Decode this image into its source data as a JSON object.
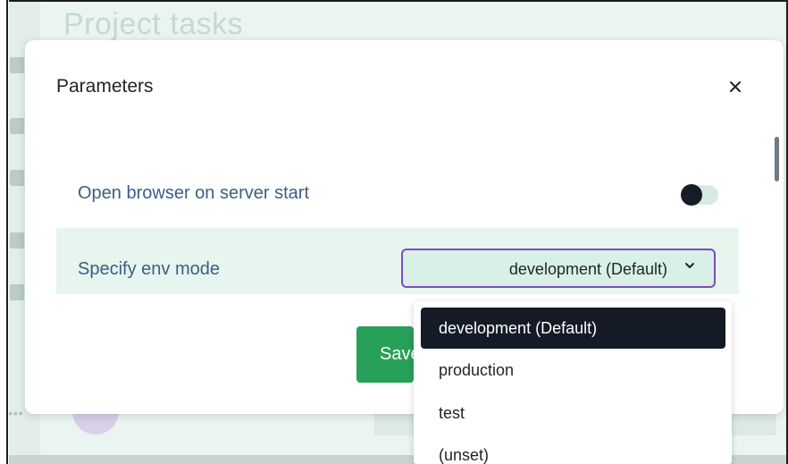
{
  "background": {
    "page_title": "Project tasks"
  },
  "modal": {
    "title": "Parameters",
    "close_icon": "close-icon",
    "settings": [
      {
        "label": "Open browser on server start",
        "type": "toggle",
        "checked": true
      },
      {
        "label": "Specify env mode",
        "type": "select",
        "value": "development (Default)"
      }
    ],
    "save_label": "Save"
  },
  "dropdown": {
    "options": [
      "development (Default)",
      "production",
      "test",
      "(unset)"
    ],
    "selected_index": 0
  },
  "colors": {
    "accent_purple": "#7b4cc4",
    "save_green": "#27a05a",
    "label_blue": "#3a5f83",
    "row_highlight": "#e7f5ef",
    "selected_option": "#141a26"
  }
}
